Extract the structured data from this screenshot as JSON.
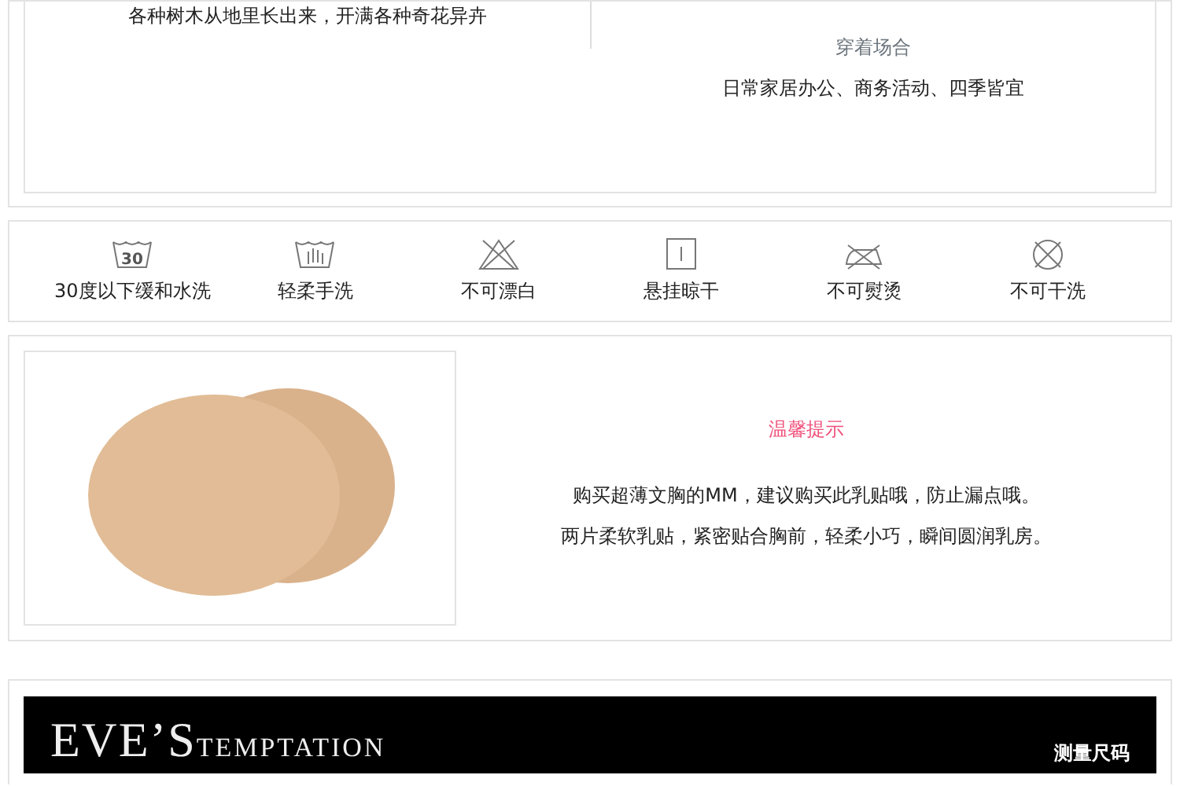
{
  "intro": {
    "left_text": "各种树木从地里长出来，开满各种奇花异卉",
    "occasion_label": "穿着场合",
    "occasion_text": "日常家居办公、商务活动、四季皆宜"
  },
  "care": [
    {
      "kind": "wash30",
      "number": "30",
      "label": "30度以下缓和水洗"
    },
    {
      "kind": "handwash",
      "label": "轻柔手洗"
    },
    {
      "kind": "nobleach",
      "label": "不可漂白"
    },
    {
      "kind": "hangdry",
      "label": "悬挂晾干"
    },
    {
      "kind": "noiron",
      "label": "不可熨烫"
    },
    {
      "kind": "nodryclean",
      "label": "不可干洗"
    }
  ],
  "tip": {
    "title": "温馨提示",
    "lines": [
      "购买超薄文胸的MM，建议购买此乳贴哦，防止漏点哦。",
      "两片柔软乳贴，紧密贴合胸前，轻柔小巧，瞬间圆润乳房。"
    ]
  },
  "banner": {
    "brand_main": "EVE’S",
    "brand_sub": "TEMPTATION",
    "link": "测量尺码"
  }
}
